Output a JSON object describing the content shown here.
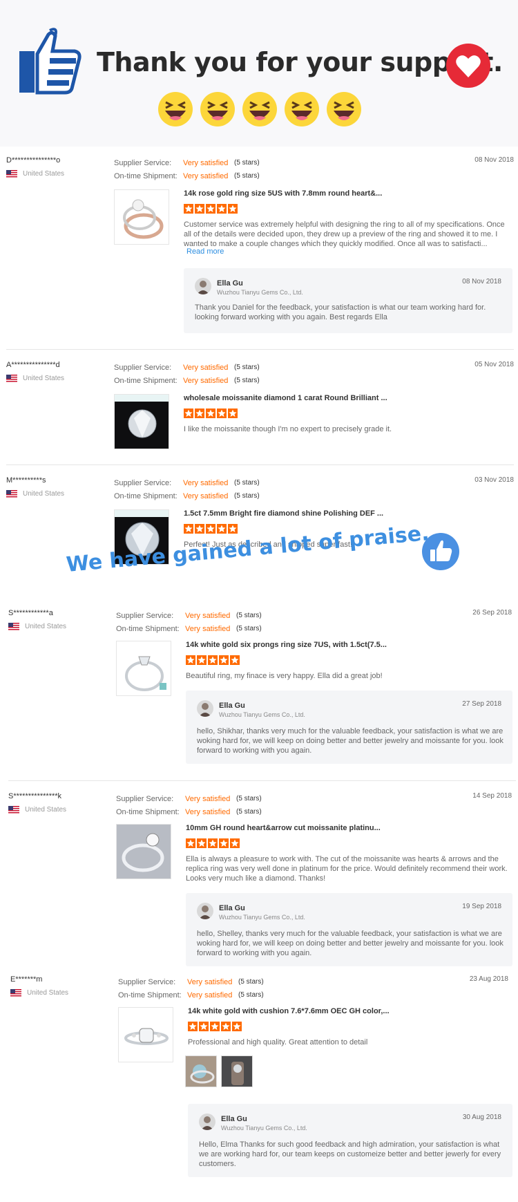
{
  "banner": {
    "title": "Thank you for your support."
  },
  "praise": {
    "text": "We have gained a lot of praise."
  },
  "labels": {
    "supplier_service": "Supplier Service:",
    "ontime_shipment": "On-time Shipment:",
    "very_satisfied": "Very satisfied",
    "five_stars": "(5 stars)",
    "read_more": "Read more"
  },
  "reviews": [
    {
      "user": "D***************o",
      "country": "United States",
      "date": "08 Nov 2018",
      "product": "14k rose gold ring size 5US with 7.8mm round heart&...",
      "text": "Customer service was extremely helpful with designing the ring to all of my specifications. Once all of the details were decided upon, they drew up a preview of the ring and showed it to me. I wanted to make a couple changes which they quickly modified. Once all was to satisfacti...",
      "reply": {
        "name": "Ella Gu",
        "company": "Wuzhou Tianyu Gems Co., Ltd.",
        "date": "08 Nov 2018",
        "text": "Thank you Daniel for the feedback, your satisfaction is what our team working hard for. looking forward working with you again. Best regards Ella"
      }
    },
    {
      "user": "A***************d",
      "country": "United States",
      "date": "05 Nov 2018",
      "product": "wholesale moissanite diamond 1 carat Round Brilliant ...",
      "text": "I like the moissanite though I'm no expert to precisely grade it."
    },
    {
      "user": "M**********s",
      "country": "United States",
      "date": "03 Nov 2018",
      "product": "1.5ct 7.5mm Bright fire diamond shine Polishing DEF ...",
      "text": "Perfect! Just as described and shipped super fast!"
    },
    {
      "user": "S************a",
      "country": "United States",
      "date": "26 Sep 2018",
      "product": "14k white gold six prongs ring size 7US, with 1.5ct(7.5...",
      "text": "Beautiful ring, my finace is very happy. Ella did a great job!",
      "reply": {
        "name": "Ella Gu",
        "company": "Wuzhou Tianyu Gems Co., Ltd.",
        "date": "27 Sep 2018",
        "text": "hello, Shikhar, thanks very much for the valuable feedback, your satisfaction is what we are woking hard for, we will keep on doing better and better jewelry and moissante for you. look forward to working with you again."
      }
    },
    {
      "user": "S***************k",
      "country": "United States",
      "date": "14 Sep 2018",
      "product": "10mm GH round heart&arrow cut moissanite platinu...",
      "text": "Ella is always a pleasure to work with. The cut of the moissanite was hearts & arrows and the replica ring was very well done in platinum for the price. Would definitely recommend their work. Looks very much like a diamond. Thanks!",
      "reply": {
        "name": "Ella Gu",
        "company": "Wuzhou Tianyu Gems Co., Ltd.",
        "date": "19 Sep 2018",
        "text": "hello, Shelley, thanks very much for the valuable feedback, your satisfaction is what we are woking hard for, we will keep on doing better and better jewelry and moissante for you. look forward to working with you again."
      }
    },
    {
      "user": "E*******m",
      "country": "United States",
      "date": "23 Aug 2018",
      "product": "14k white gold with cushion 7.6*7.6mm OEC GH color,...",
      "text": "Professional and high quality. Great attention to detail",
      "reply": {
        "name": "Ella Gu",
        "company": "Wuzhou Tianyu Gems Co., Ltd.",
        "date": "30 Aug 2018",
        "text": "Hello, Elma Thanks for such good feedback and high admiration, your satisfaction is what we are working hard for, our team keeps on customeize better and better jewerly for every customers."
      }
    }
  ]
}
